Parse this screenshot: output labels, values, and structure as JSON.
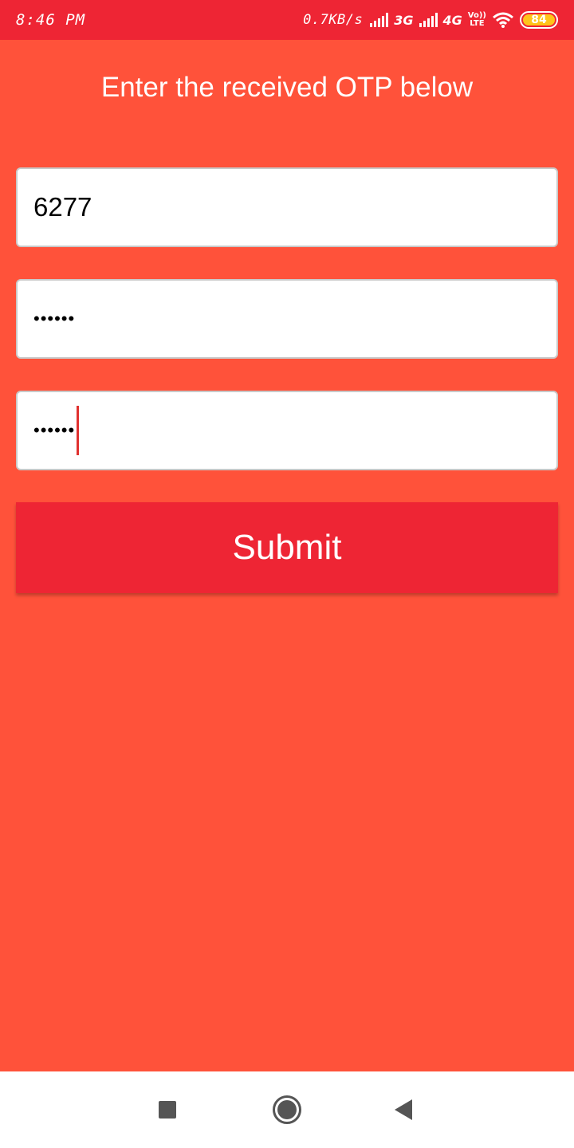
{
  "status_bar": {
    "time": "8:46 PM",
    "net_speed": "0.7KB/s",
    "network_1": "3G",
    "network_2": "4G",
    "volte_top": "Vo))",
    "volte_bottom": "LTE",
    "battery": "84",
    "colors": {
      "background": "#EE2534",
      "battery": "#FFC41A"
    }
  },
  "page": {
    "title": "Enter the received OTP below",
    "background": "#FF523A"
  },
  "form": {
    "otp_value": "6277",
    "password_value": "••••••",
    "confirm_value": "••••••",
    "submit_label": "Submit",
    "submit_color": "#EE2534"
  },
  "nav_bar": {
    "icons": [
      "recent-apps-icon",
      "home-icon",
      "back-icon"
    ]
  }
}
